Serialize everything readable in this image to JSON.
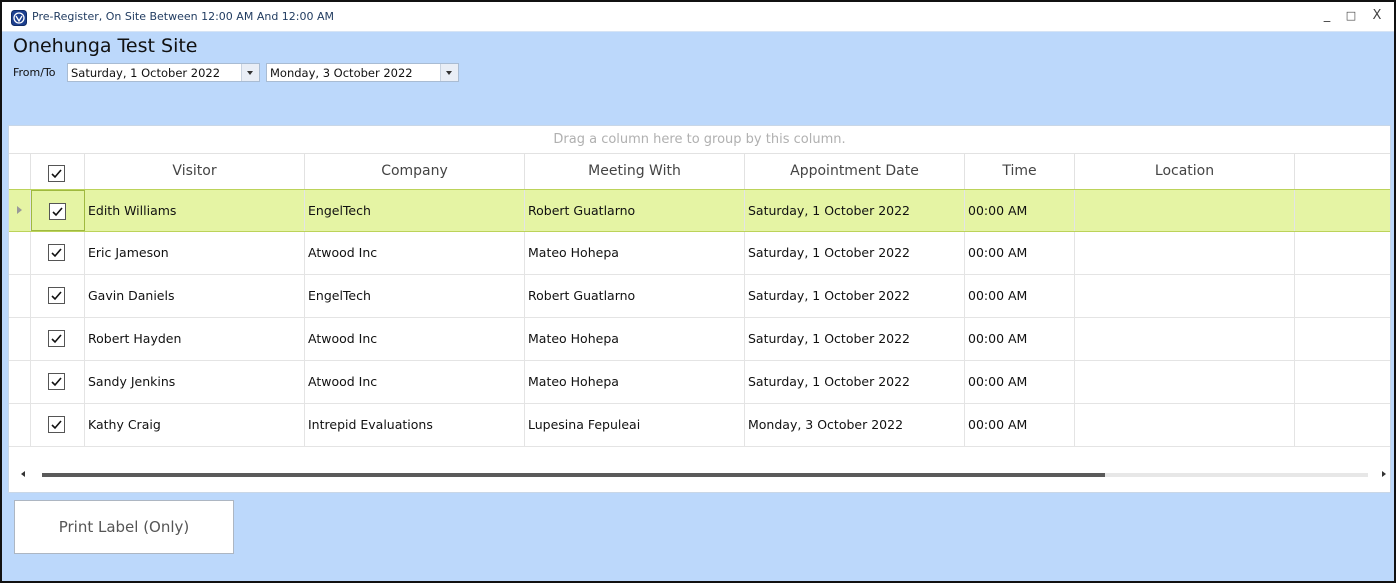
{
  "window": {
    "title": "Pre-Register, On Site Between 12:00 AM And 12:00 AM",
    "controls": {
      "minimize": "_",
      "maximize": "□",
      "close": "X"
    }
  },
  "header": {
    "site_title": "Onehunga Test Site",
    "from_to_label": "From/To",
    "from_date": "Saturday, 1 October 2022",
    "to_date": "Monday, 3 October 2022"
  },
  "grid": {
    "group_panel_text": "Drag a column here to group by this column.",
    "columns": [
      "Visitor",
      "Company",
      "Meeting With",
      "Appointment Date",
      "Time",
      "Location"
    ],
    "header_checked": true,
    "selected_row": 0,
    "rows": [
      {
        "checked": true,
        "visitor": "Edith Williams",
        "company": "EngelTech",
        "meeting_with": "Robert Guatlarno",
        "appointment_date": "Saturday, 1 October 2022",
        "time": "00:00 AM",
        "location": ""
      },
      {
        "checked": true,
        "visitor": "Eric Jameson",
        "company": "Atwood Inc",
        "meeting_with": "Mateo Hohepa",
        "appointment_date": "Saturday, 1 October 2022",
        "time": "00:00 AM",
        "location": ""
      },
      {
        "checked": true,
        "visitor": "Gavin Daniels",
        "company": "EngelTech",
        "meeting_with": "Robert Guatlarno",
        "appointment_date": "Saturday, 1 October 2022",
        "time": "00:00 AM",
        "location": ""
      },
      {
        "checked": true,
        "visitor": "Robert Hayden",
        "company": "Atwood Inc",
        "meeting_with": "Mateo Hohepa",
        "appointment_date": "Saturday, 1 October 2022",
        "time": "00:00 AM",
        "location": ""
      },
      {
        "checked": true,
        "visitor": "Sandy Jenkins",
        "company": "Atwood Inc",
        "meeting_with": "Mateo Hohepa",
        "appointment_date": "Saturday, 1 October 2022",
        "time": "00:00 AM",
        "location": ""
      },
      {
        "checked": true,
        "visitor": "Kathy Craig",
        "company": "Intrepid Evaluations",
        "meeting_with": "Lupesina Fepuleai",
        "appointment_date": "Monday, 3 October 2022",
        "time": "00:00 AM",
        "location": ""
      }
    ],
    "scroll_position": 0.8
  },
  "actions": {
    "print_label": "Print Label (Only)"
  },
  "colors": {
    "window_bg": "#bcd8fb",
    "selected_row": "#e5f4a4",
    "title_text": "#1f3a5f"
  }
}
